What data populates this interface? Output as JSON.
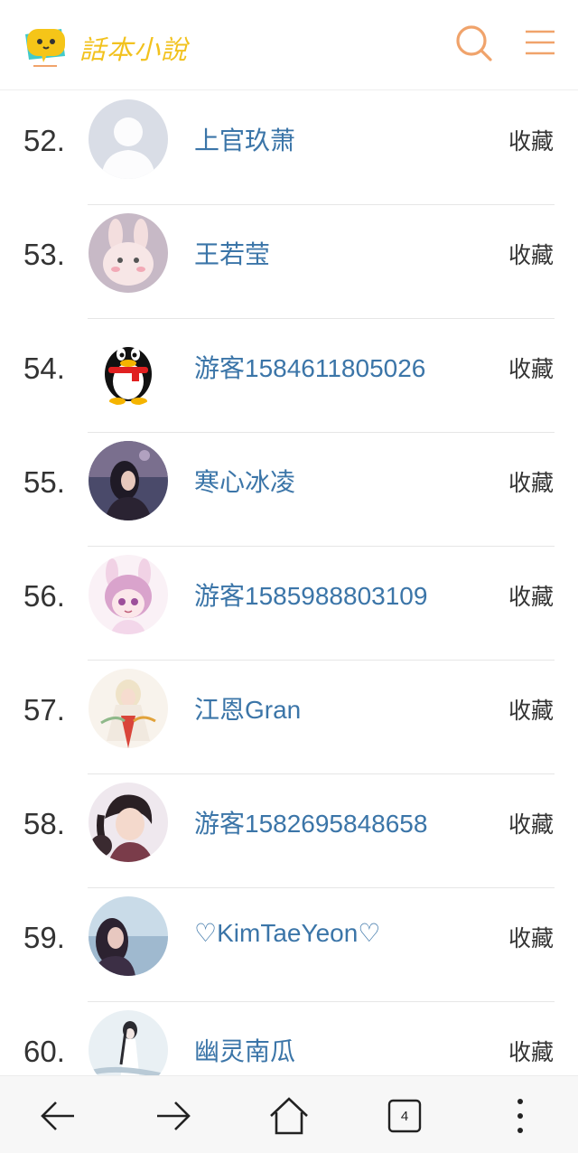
{
  "app": {
    "logo_text": "話本小說",
    "accent_color": "#f0a36b",
    "logo_yellow": "#f2c21e",
    "link_color": "#3b75a8"
  },
  "header": {
    "search_icon": "search-icon",
    "menu_icon": "hamburger-menu-icon"
  },
  "list": {
    "items": [
      {
        "rank": "52.",
        "name": "上官玖萧",
        "action": "收藏",
        "avatar": "default-person-avatar"
      },
      {
        "rank": "53.",
        "name": "王若莹",
        "action": "收藏",
        "avatar": "bunny-avatar"
      },
      {
        "rank": "54.",
        "name": "游客1584611805026",
        "action": "收藏",
        "avatar": "penguin-avatar"
      },
      {
        "rank": "55.",
        "name": "寒心冰凌",
        "action": "收藏",
        "avatar": "girl-photo-avatar"
      },
      {
        "rank": "56.",
        "name": "游客1585988803109",
        "action": "收藏",
        "avatar": "anime-girl-avatar"
      },
      {
        "rank": "57.",
        "name": "江恩Gran",
        "action": "收藏",
        "avatar": "anime-figure-avatar"
      },
      {
        "rank": "58.",
        "name": "游客1582695848658",
        "action": "收藏",
        "avatar": "anime-boy-avatar"
      },
      {
        "rank": "59.",
        "name": "♡KimTaeYeon♡",
        "action": "收藏",
        "avatar": "lake-photo-avatar"
      },
      {
        "rank": "60.",
        "name": "幽灵南瓜",
        "action": "收藏",
        "avatar": "ink-girl-avatar"
      }
    ]
  },
  "browser_bar": {
    "back_icon": "arrow-left-icon",
    "forward_icon": "arrow-right-icon",
    "home_icon": "home-icon",
    "tabs_count": "4",
    "more_icon": "more-vertical-icon"
  }
}
